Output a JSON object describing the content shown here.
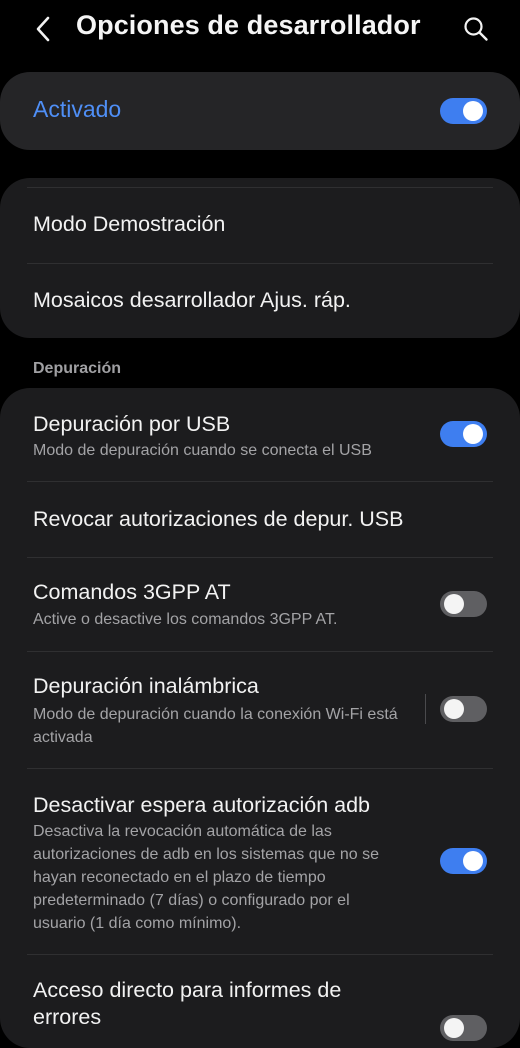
{
  "header": {
    "title": "Opciones de desarrollador",
    "back_icon": "back-arrow-icon",
    "search_icon": "search-icon"
  },
  "master": {
    "label": "Activado",
    "enabled": true
  },
  "general_items": [
    {
      "title": "Modo Demostración"
    },
    {
      "title": "Mosaicos desarrollador Ajus. ráp."
    }
  ],
  "debug_section": {
    "header": "Depuración",
    "items": [
      {
        "title": "Depuración por USB",
        "subtitle": "Modo de depuración cuando se conecta el USB",
        "toggle": true
      },
      {
        "title": "Revocar autorizaciones de depur. USB"
      },
      {
        "title": "Comandos 3GPP AT",
        "subtitle": "Active o desactive los comandos 3GPP AT.",
        "toggle": false
      },
      {
        "title": "Depuración inalámbrica",
        "subtitle": "Modo de depuración cuando la conexión Wi-Fi está activada",
        "toggle": false
      },
      {
        "title": "Desactivar espera autorización adb",
        "subtitle": "Desactiva la revocación automática de las autorizaciones de adb en los sistemas que no se hayan reconectado en el plazo de tiempo predeterminado (7 días) o configurado por el usuario (1 día como mínimo).",
        "toggle": true
      },
      {
        "title": "Acceso directo para informes de errores",
        "toggle": false
      }
    ]
  },
  "colors": {
    "accent": "#4f8ff6",
    "toggle_on": "#3e7ef0",
    "toggle_off": "#5f5f62",
    "card_bg": "#1c1c1e",
    "master_card_bg": "#252527",
    "background": "#000000"
  }
}
